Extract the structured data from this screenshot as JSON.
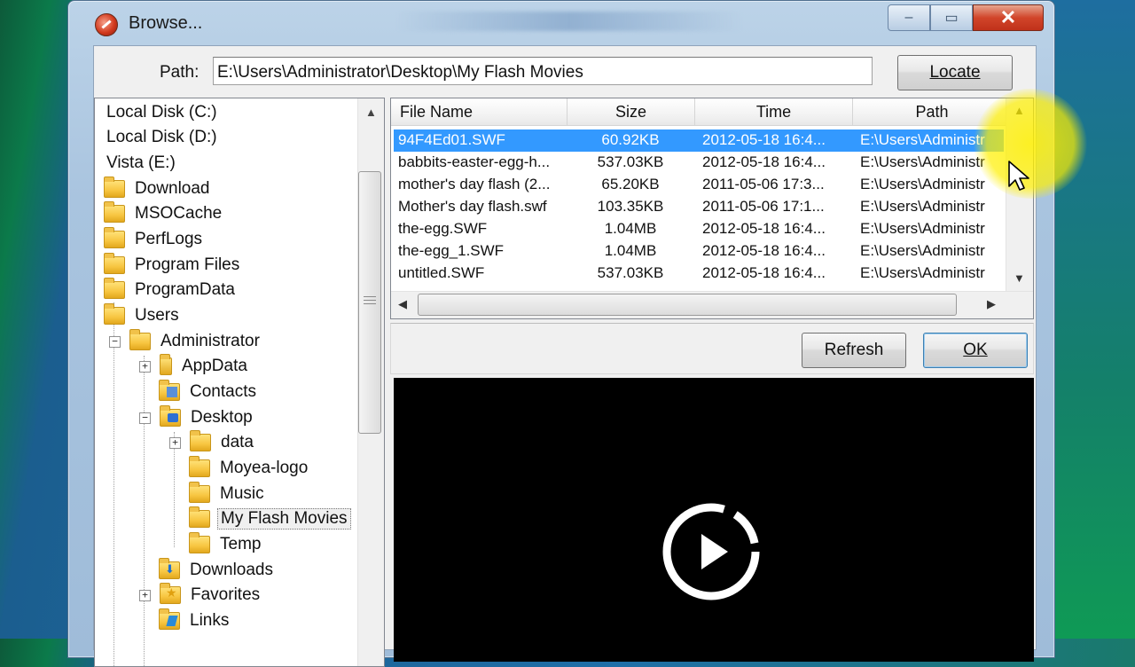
{
  "window": {
    "title": "Browse...",
    "caption": {
      "minimize": "‒",
      "maximize": "▭",
      "close": "✕"
    }
  },
  "path": {
    "label": "Path:",
    "value": "E:\\Users\\Administrator\\Desktop\\My Flash Movies"
  },
  "buttons": {
    "locate": "Locate",
    "refresh": "Refresh",
    "ok": "OK"
  },
  "tree": {
    "items": [
      {
        "label": "Local Disk (C:)"
      },
      {
        "label": "Local Disk (D:)"
      },
      {
        "label": "Vista (E:)"
      },
      {
        "label": "Download"
      },
      {
        "label": "MSOCache"
      },
      {
        "label": "PerfLogs"
      },
      {
        "label": "Program Files"
      },
      {
        "label": "ProgramData"
      },
      {
        "label": "Users"
      },
      {
        "label": "Administrator"
      },
      {
        "label": "AppData"
      },
      {
        "label": "Contacts"
      },
      {
        "label": "Desktop"
      },
      {
        "label": "data"
      },
      {
        "label": "Moyea-logo"
      },
      {
        "label": "Music"
      },
      {
        "label": "My Flash Movies"
      },
      {
        "label": "Temp"
      },
      {
        "label": "Downloads"
      },
      {
        "label": "Favorites"
      },
      {
        "label": "Links"
      }
    ],
    "expander_plus": "+",
    "expander_minus": "−"
  },
  "list": {
    "columns": [
      "File Name",
      "Size",
      "Time",
      "Path"
    ],
    "rows": [
      [
        "94F4Ed01.SWF",
        "60.92KB",
        "2012-05-18 16:4...",
        "E:\\Users\\Administr"
      ],
      [
        "babbits-easter-egg-h...",
        "537.03KB",
        "2012-05-18 16:4...",
        "E:\\Users\\Administr"
      ],
      [
        "mother's day flash (2...",
        "65.20KB",
        "2011-05-06 17:3...",
        "E:\\Users\\Administr"
      ],
      [
        "Mother's day flash.swf",
        "103.35KB",
        "2011-05-06 17:1...",
        "E:\\Users\\Administr"
      ],
      [
        "the-egg.SWF",
        "1.04MB",
        "2012-05-18 16:4...",
        "E:\\Users\\Administr"
      ],
      [
        "the-egg_1.SWF",
        "1.04MB",
        "2012-05-18 16:4...",
        "E:\\Users\\Administr"
      ],
      [
        "untitled.SWF",
        "537.03KB",
        "2012-05-18 16:4...",
        "E:\\Users\\Administr"
      ]
    ]
  },
  "preview": {
    "state": "stopped"
  }
}
